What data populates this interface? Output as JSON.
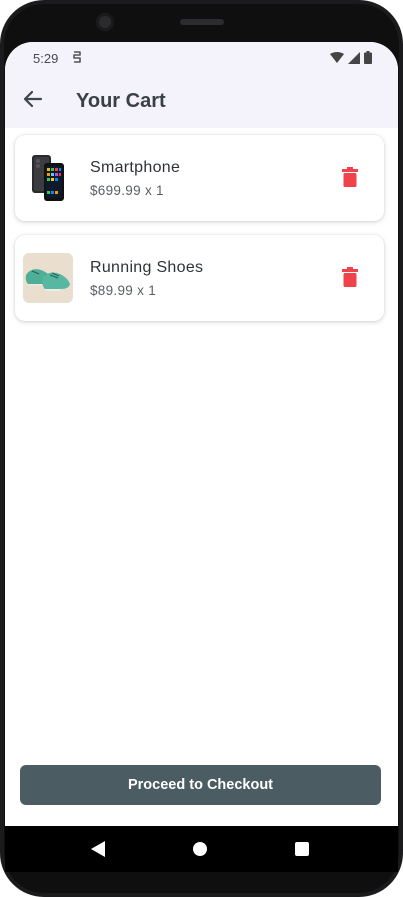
{
  "status_bar": {
    "time": "5:29"
  },
  "header": {
    "title": "Your Cart",
    "back_icon": "arrow-left-icon"
  },
  "cart": {
    "items": [
      {
        "name": "Smartphone",
        "price_line": "$699.99 x 1",
        "image": "smartphone-image",
        "delete_icon": "trash-icon"
      },
      {
        "name": "Running Shoes",
        "price_line": "$89.99 x 1",
        "image": "running-shoes-image",
        "delete_icon": "trash-icon"
      }
    ]
  },
  "checkout": {
    "label": "Proceed to Checkout"
  },
  "colors": {
    "app_bar": "#f4f2fa",
    "title": "#3a4046",
    "delete": "#f0424a",
    "checkout_button": "#4b5d63"
  }
}
